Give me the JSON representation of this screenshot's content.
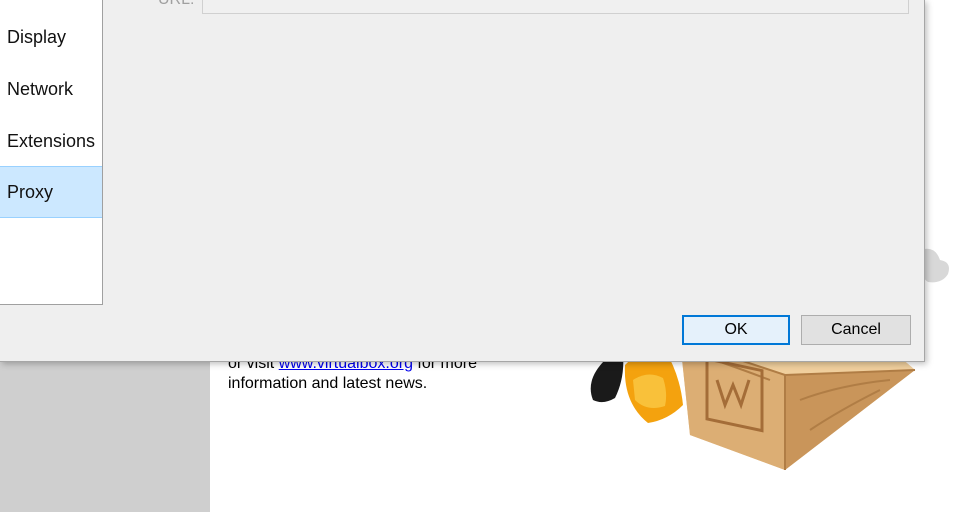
{
  "background": {
    "welcome_prefix": "or visit",
    "welcome_link": "www.virtualbox.org",
    "welcome_suffix": "for more",
    "welcome_line2": "information and latest news."
  },
  "dialog": {
    "sidebar": {
      "items": [
        {
          "label": "Display"
        },
        {
          "label": "Network"
        },
        {
          "label": "Extensions"
        },
        {
          "label": "Proxy",
          "selected": true
        }
      ]
    },
    "proxy": {
      "url_label": "URL:",
      "url_value": ""
    },
    "buttons": {
      "ok_label": "OK",
      "cancel_label": "Cancel"
    }
  },
  "colors": {
    "selection": "#cce8ff",
    "dialog_bg": "#efefef",
    "default_button_border": "#0078d7",
    "link": "#0000ee"
  },
  "icons": {
    "mascot": "virtualbox-mascot-icon"
  }
}
